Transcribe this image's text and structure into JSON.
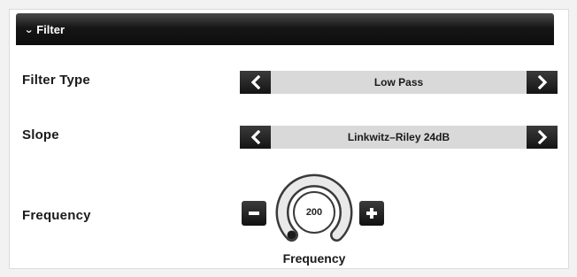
{
  "filter_section": {
    "title": "Filter",
    "expanded": true
  },
  "filter_type": {
    "label": "Filter Type",
    "value": "Low Pass"
  },
  "slope": {
    "label": "Slope",
    "value": "Linkwitz–Riley 24dB"
  },
  "frequency": {
    "label": "Frequency",
    "value": "200",
    "knob_caption": "Frequency"
  },
  "icons": {
    "collapse": "chevron-down-icon",
    "prev": "chevron-left-icon",
    "next": "chevron-right-icon",
    "decrease": "minus-icon",
    "increase": "plus-icon"
  },
  "colors": {
    "header_bg": "#111111",
    "selector_bg": "#d9d9d9",
    "button_bg": "#1c1c1c",
    "knob_ring": "#e6e6e6"
  }
}
